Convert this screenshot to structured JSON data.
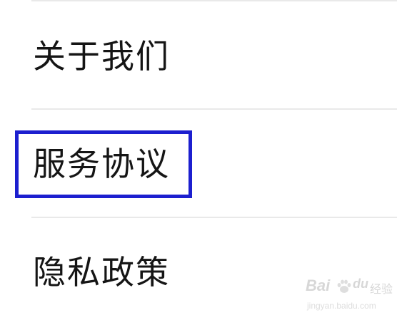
{
  "menu": {
    "items": [
      {
        "label": "关于我们"
      },
      {
        "label": "服务协议"
      },
      {
        "label": "隐私政策"
      }
    ],
    "highlighted_item": "服务协议"
  },
  "colors": {
    "background": "#ffffff",
    "text": "#151515",
    "divider": "#e9e9e9",
    "highlight_border": "#1c1fcf"
  },
  "watermark": {
    "logo_text": "Bai",
    "logo_text_suffix": "du",
    "brand_suffix": "经验",
    "url": "jingyan.baidu.com"
  }
}
